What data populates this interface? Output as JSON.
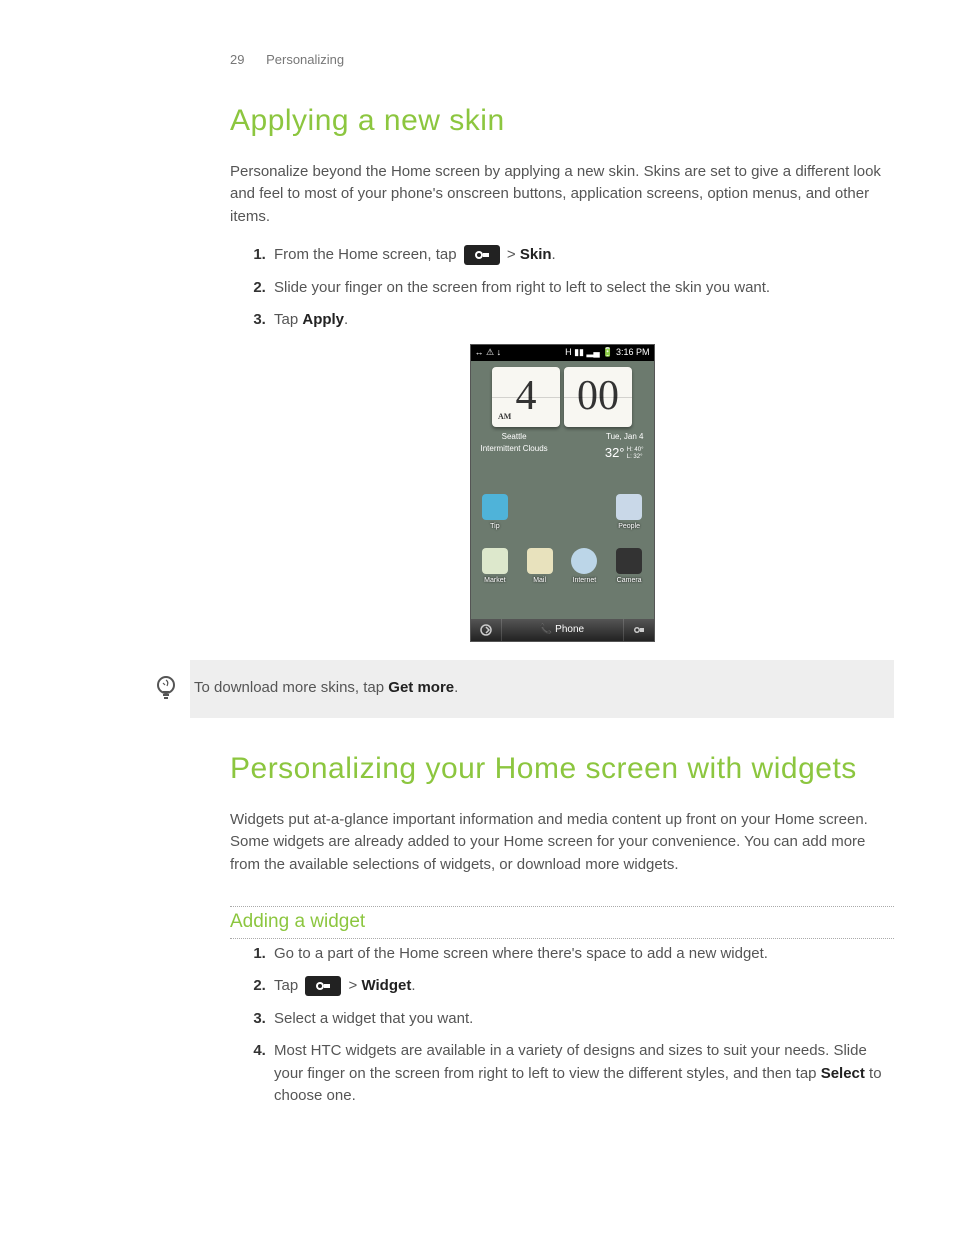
{
  "header": {
    "page_number": "29",
    "section": "Personalizing"
  },
  "sec1": {
    "title": "Applying a new skin",
    "intro": "Personalize beyond the Home screen by applying a new skin. Skins are set to give a different look and feel to most of your phone's onscreen buttons, application screens, option menus, and other items.",
    "step1_pre": "From the Home screen, tap ",
    "step1_mid": " > ",
    "step1_bold": "Skin",
    "step1_post": ".",
    "step2": "Slide your finger on the screen from right to left to select the skin you want.",
    "step3_pre": "Tap ",
    "step3_bold": "Apply",
    "step3_post": "."
  },
  "phone": {
    "status_left": "↔ ⚠ ↓",
    "status_right": "H ▮▮ ▂▄ 🔋 3:16 PM",
    "clock_h": "4",
    "clock_m": "00",
    "ampm": "AM",
    "city": "Seattle",
    "cond": "Intermittent Clouds",
    "date": "Tue, Jan 4",
    "temp": "32°",
    "hi": "H: 40°",
    "lo": "L: 32°",
    "apps_row1": [
      "Tip",
      "",
      "",
      "People"
    ],
    "apps_row2": [
      "Market",
      "Mail",
      "Internet",
      "Camera"
    ],
    "dock_label": "📞 Phone"
  },
  "tip": {
    "pre": "To download more skins, tap ",
    "bold": "Get more",
    "post": "."
  },
  "sec2": {
    "title": "Personalizing your Home screen with widgets",
    "intro": "Widgets put at-a-glance important information and media content up front on your Home screen. Some widgets are already added to your Home screen for your convenience. You can add more from the available selections of widgets, or download more widgets.",
    "sub": "Adding a widget",
    "s1": "Go to a part of the Home screen where there's space to add a new widget.",
    "s2_pre": "Tap ",
    "s2_mid": " > ",
    "s2_bold": "Widget",
    "s2_post": ".",
    "s3": "Select a widget that you want.",
    "s4_pre": "Most HTC widgets are available in a variety of designs and sizes to suit your needs. Slide your finger on the screen from right to left to view the different styles, and then tap ",
    "s4_bold": "Select",
    "s4_post": " to choose one."
  }
}
